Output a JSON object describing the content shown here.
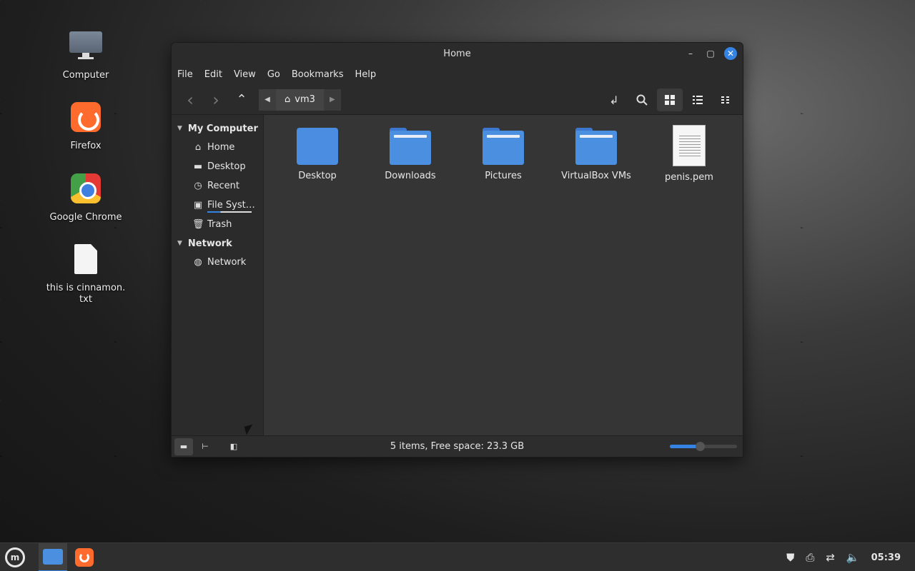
{
  "desktop": {
    "icons": [
      {
        "label": "Computer",
        "icon": "computer-icon"
      },
      {
        "label": "Firefox",
        "icon": "firefox-icon"
      },
      {
        "label": "Google Chrome",
        "icon": "chrome-icon"
      },
      {
        "label": "this is cinnamon.\ntxt",
        "icon": "text-file-icon"
      }
    ]
  },
  "window": {
    "title": "Home",
    "controls": {
      "minimize": "–",
      "maximize": "▢",
      "close": "✕"
    },
    "menu": [
      "File",
      "Edit",
      "View",
      "Go",
      "Bookmarks",
      "Help"
    ],
    "toolbar": {
      "back": "‹",
      "forward": "›",
      "up": "⌃",
      "breadcrumb": "vm3",
      "icons": [
        "back-icon",
        "forward-icon",
        "up-icon",
        "toggle-location-icon",
        "search-icon",
        "icon-view-icon",
        "list-view-icon",
        "compact-view-icon"
      ]
    },
    "sidebar": {
      "sections": [
        {
          "title": "My Computer",
          "items": [
            "Home",
            "Desktop",
            "Recent",
            "File Syst…",
            "Trash"
          ]
        },
        {
          "title": "Network",
          "items": [
            "Network"
          ]
        }
      ]
    },
    "files": [
      {
        "name": "Desktop",
        "type": "folder-desktop"
      },
      {
        "name": "Downloads",
        "type": "folder"
      },
      {
        "name": "Pictures",
        "type": "folder"
      },
      {
        "name": "VirtualBox VMs",
        "type": "folder"
      },
      {
        "name": "penis.pem",
        "type": "document"
      }
    ],
    "status": "5 items, Free space: 23.3 GB",
    "zoom_level": 0.45
  },
  "taskbar": {
    "clock": "05:39",
    "tray_icons": [
      "shield-icon",
      "printer-icon",
      "network-icon",
      "volume-icon"
    ]
  },
  "colors": {
    "accent": "#3584e4",
    "folder": "#4a8fe0",
    "window_bg": "#2b2b2b",
    "content_bg": "#353535"
  }
}
